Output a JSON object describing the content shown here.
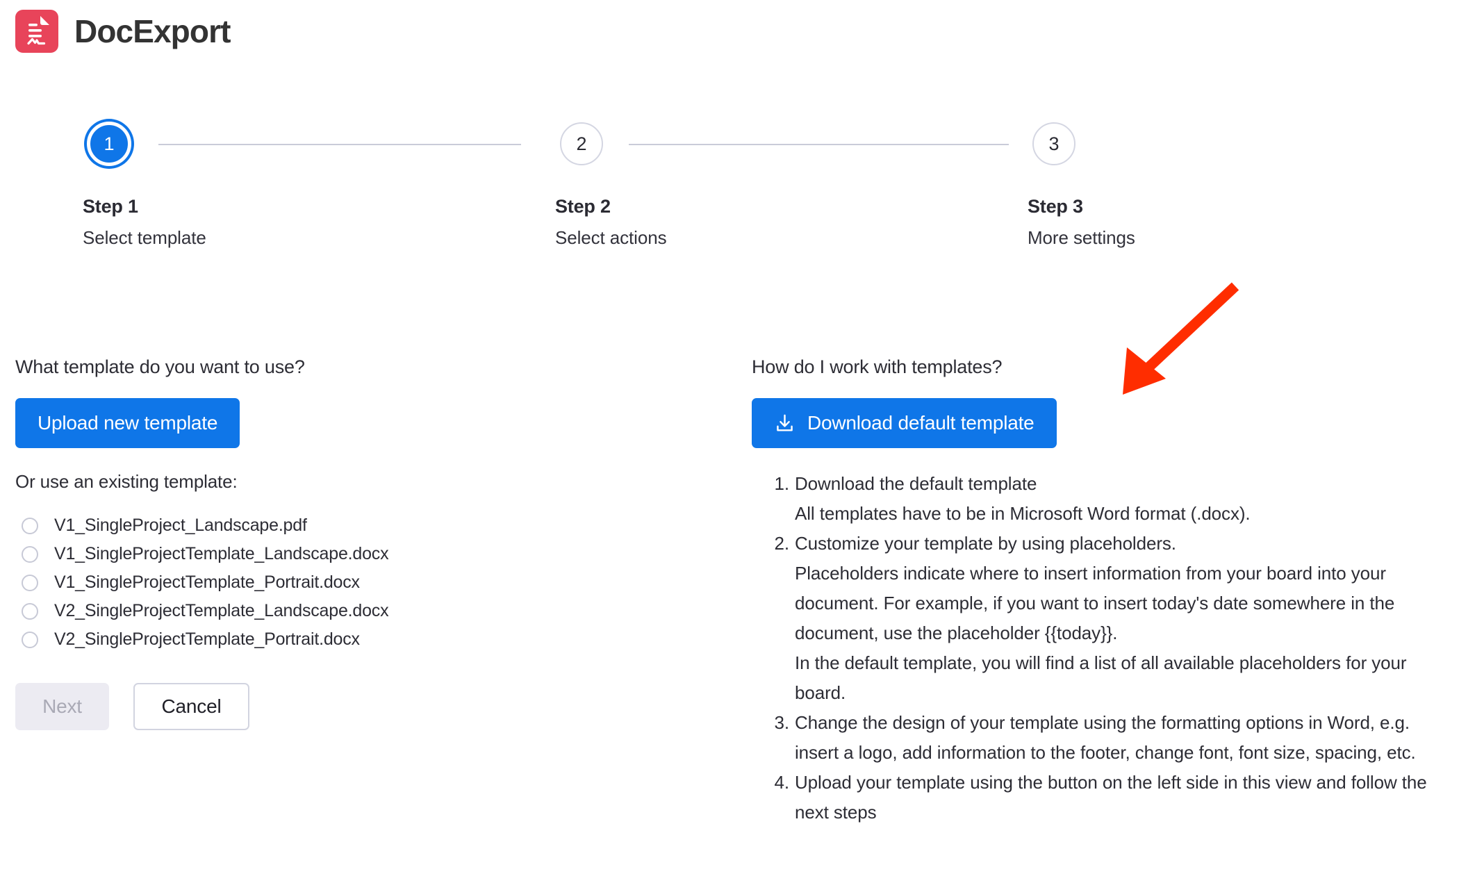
{
  "app": {
    "title": "DocExport",
    "logo_color": "#e8445a",
    "accent_color": "#0f76e8"
  },
  "stepper": {
    "steps": [
      {
        "number": "1",
        "title": "Step 1",
        "subtitle": "Select template",
        "state": "active"
      },
      {
        "number": "2",
        "title": "Step 2",
        "subtitle": "Select actions",
        "state": "inactive"
      },
      {
        "number": "3",
        "title": "Step 3",
        "subtitle": "More settings",
        "state": "inactive"
      }
    ]
  },
  "left": {
    "question": "What template do you want to use?",
    "upload_button": "Upload new template",
    "existing_label": "Or use an existing template:",
    "templates": [
      {
        "name": "V1_SingleProject_Landscape.pdf",
        "selected": false
      },
      {
        "name": "V1_SingleProjectTemplate_Landscape.docx",
        "selected": false
      },
      {
        "name": "V1_SingleProjectTemplate_Portrait.docx",
        "selected": false
      },
      {
        "name": "V2_SingleProjectTemplate_Landscape.docx",
        "selected": false
      },
      {
        "name": "V2_SingleProjectTemplate_Portrait.docx",
        "selected": false
      }
    ],
    "next_button": "Next",
    "next_disabled": true,
    "cancel_button": "Cancel"
  },
  "right": {
    "question": "How do I work with templates?",
    "download_button": "Download default template",
    "download_icon": "download-icon",
    "instructions": [
      {
        "main": "Download the default template",
        "lines": [
          "All templates have to be in Microsoft Word format (.docx)."
        ]
      },
      {
        "main": "Customize your template by using placeholders.",
        "lines": [
          "Placeholders indicate where to insert information from your board into your document. For example, if you want to insert today's date somewhere in the document, use the placeholder {{today}}.",
          "In the default template, you will find a list of all available placeholders for your board."
        ]
      },
      {
        "main": "Change the design of your template using the formatting options in Word, e.g. insert a logo, add information to the footer, change font, font size, spacing, etc.",
        "lines": []
      },
      {
        "main": "Upload your template using the button on the left side in this view and follow the next steps",
        "lines": []
      }
    ]
  },
  "annotation": {
    "arrow_color": "#ff2d00",
    "points_to": "download-default-template-button"
  }
}
